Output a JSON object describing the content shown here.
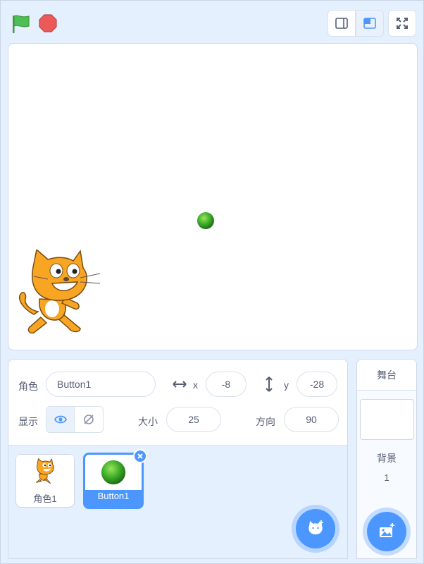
{
  "sprite_info": {
    "sprite_label": "角色",
    "sprite_name": "Button1",
    "x_label": "x",
    "x_value": "-8",
    "y_label": "y",
    "y_value": "-28",
    "show_label": "显示",
    "size_label": "大小",
    "size_value": "25",
    "direction_label": "方向",
    "direction_value": "90"
  },
  "sprites": [
    {
      "name": "角色1",
      "icon": "cat-sprite-icon",
      "selected": false
    },
    {
      "name": "Button1",
      "icon": "green-ball-icon",
      "selected": true
    }
  ],
  "stage_panel": {
    "title": "舞台",
    "backdrops_label": "背景",
    "backdrops_count": "1"
  },
  "colors": {
    "accent": "#4c97ff",
    "background": "#e5f0ff",
    "flag": "#4cbf56",
    "stop": "#ec5959"
  }
}
